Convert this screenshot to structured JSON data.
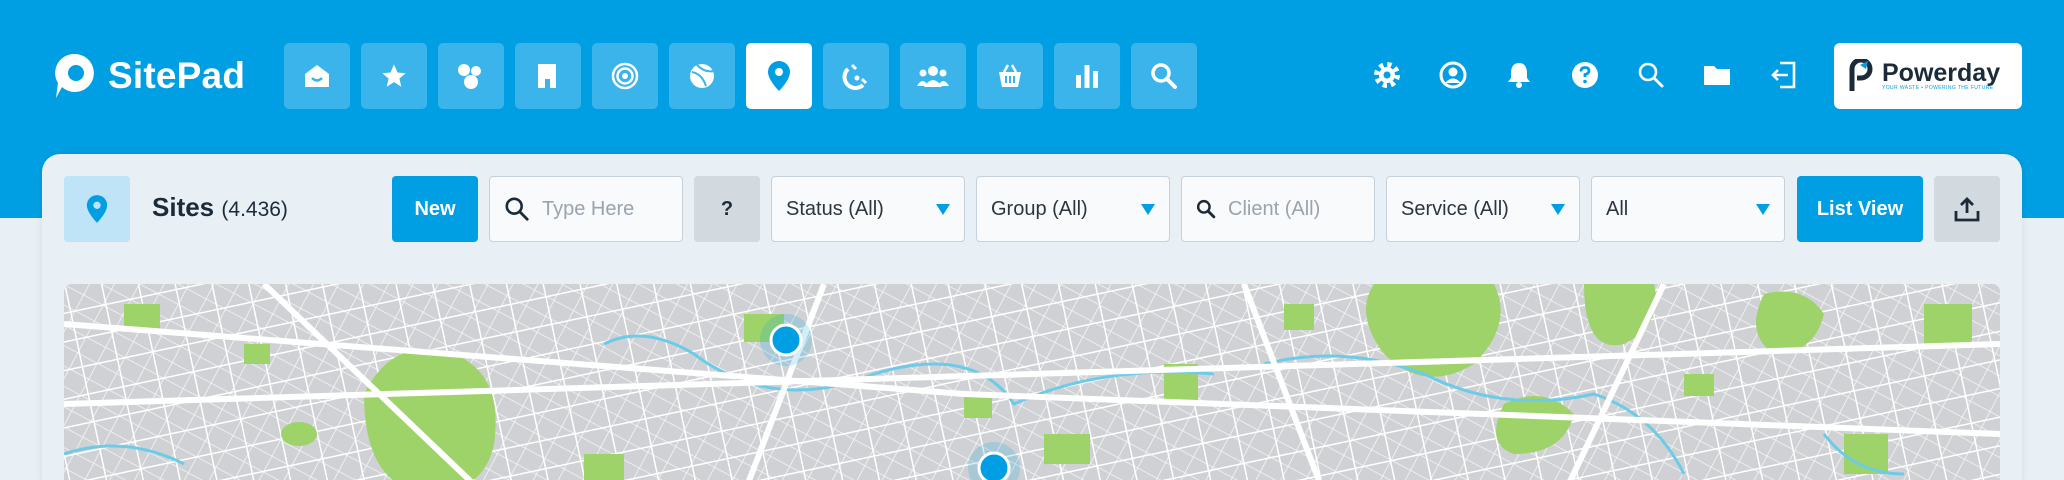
{
  "app": {
    "name": "SitePad"
  },
  "nav": {
    "items": [
      {
        "icon": "home-icon",
        "active": false
      },
      {
        "icon": "star-icon",
        "active": false
      },
      {
        "icon": "people-circles-icon",
        "active": false
      },
      {
        "icon": "building-icon",
        "active": false
      },
      {
        "icon": "target-icon",
        "active": false
      },
      {
        "icon": "ball-icon",
        "active": false
      },
      {
        "icon": "location-pin-icon",
        "active": true
      },
      {
        "icon": "magnet-icon",
        "active": false
      },
      {
        "icon": "users-group-icon",
        "active": false
      },
      {
        "icon": "basket-icon",
        "active": false
      },
      {
        "icon": "bar-chart-icon",
        "active": false
      },
      {
        "icon": "search-icon",
        "active": false
      }
    ]
  },
  "utilities": [
    "gear-icon",
    "user-circle-icon",
    "bell-icon",
    "help-icon",
    "search-icon",
    "folder-icon",
    "logout-icon"
  ],
  "brand": {
    "name": "Powerday",
    "tagline": "YOUR WASTE • POWERING THE FUTURE"
  },
  "page": {
    "title": "Sites",
    "count": "(4.436)"
  },
  "toolbar": {
    "new_label": "New",
    "search_placeholder": "Type Here",
    "help_label": "?",
    "status_value": "Status (All)",
    "group_value": "Group (All)",
    "client_placeholder": "Client (All)",
    "service_value": "Service (All)",
    "all_value": "All",
    "list_view_label": "List View"
  },
  "colors": {
    "primary": "#009fe3",
    "nav_button": "#3ab4ea",
    "park": "#9ed36a",
    "water": "#6ccbe8",
    "block": "#cfd1d4"
  }
}
